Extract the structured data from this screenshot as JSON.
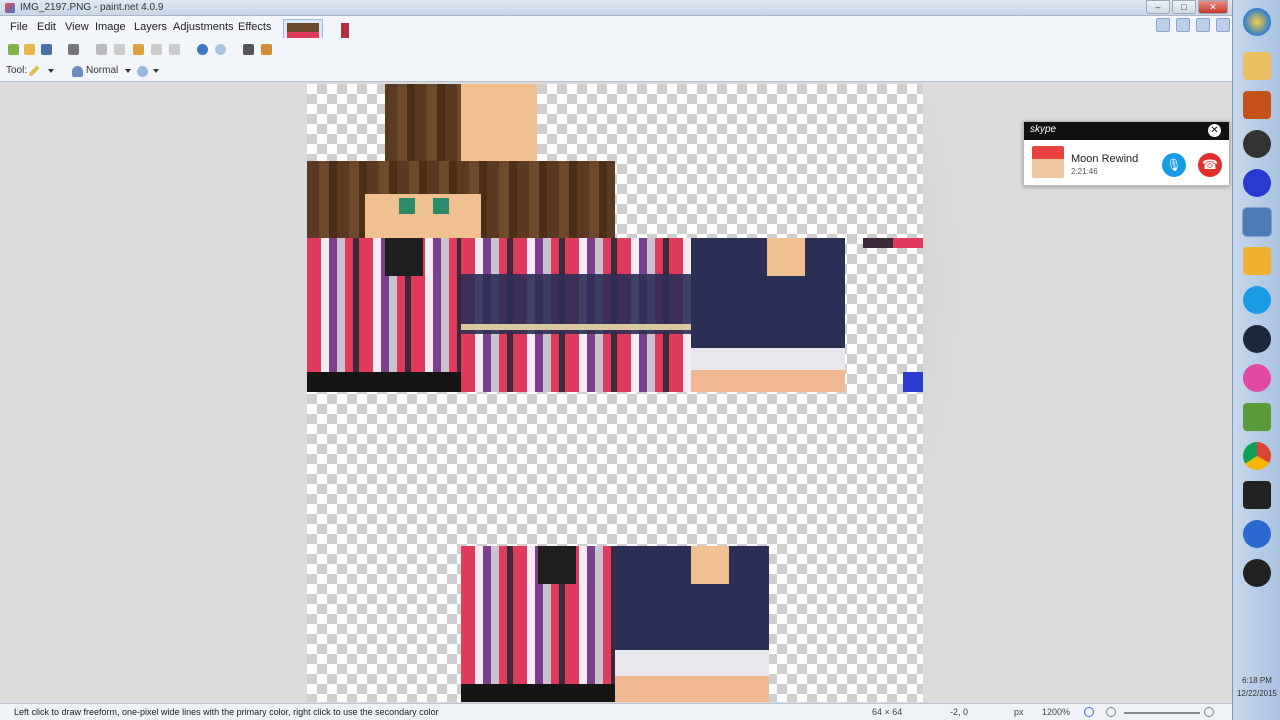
{
  "window": {
    "title": "IMG_2197.PNG - paint.net 4.0.9",
    "controls": [
      "–",
      "□",
      "✕"
    ]
  },
  "menu": [
    "File",
    "Edit",
    "View",
    "Image",
    "Layers",
    "Adjustments",
    "Effects"
  ],
  "toolbar": {
    "tool_label": "Tool:",
    "blend_mode": "Normal"
  },
  "skype": {
    "logo": "skype",
    "caller": "Moon Rewind",
    "duration": "2:21:46",
    "close": "✕",
    "mic_icon": "🎙",
    "end_icon": "☎"
  },
  "status": {
    "hint": "Left click to draw freeform, one-pixel wide lines with the primary color, right click to use the secondary color",
    "image_size": "64 × 64",
    "cursor_pos": "-2, 0",
    "units": "px",
    "zoom": "1200%"
  },
  "taskbar": {
    "clock_time": "6:18 PM",
    "clock_date": "12/22/2015"
  }
}
